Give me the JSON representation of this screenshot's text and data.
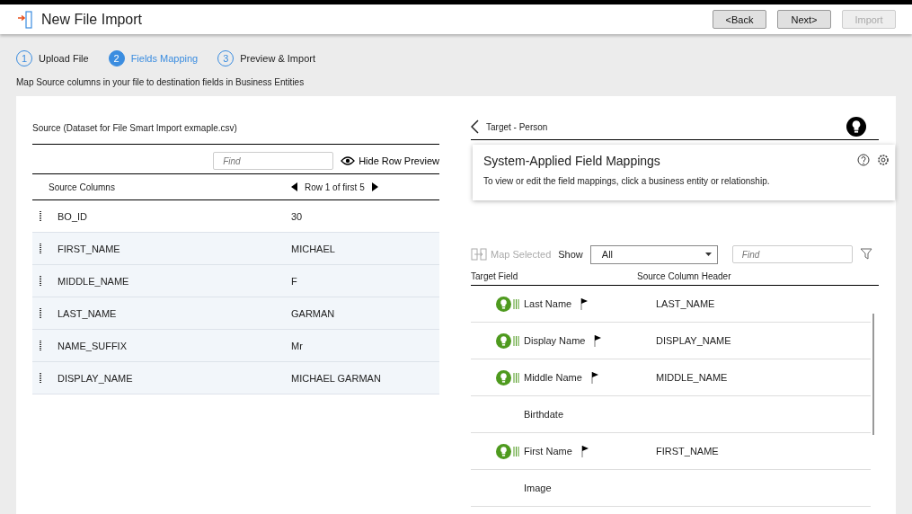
{
  "window": {
    "title": "New File Import"
  },
  "buttons": [
    {
      "label": "<Back",
      "disabled": false
    },
    {
      "label": "Next>",
      "disabled": false
    },
    {
      "label": "Import",
      "disabled": true
    }
  ],
  "steps": [
    {
      "number": "1",
      "label": "Upload File",
      "selected": false
    },
    {
      "number": "2",
      "label": "Fields Mapping",
      "selected": true
    },
    {
      "number": "3",
      "label": "Preview & Import",
      "selected": false
    }
  ],
  "instructions": "Map Source columns in your file to destination fields in Business Entities",
  "source": {
    "title": "Source (Dataset for File Smart Import exmaple.csv)",
    "find_placeholder": "Find",
    "preview_toggle": "Hide Row Preview",
    "column_header": "Source Columns",
    "row_nav": "Row 1 of first 5",
    "rows": [
      {
        "column": "BO_ID",
        "value": "30",
        "highlighted": false
      },
      {
        "column": "FIRST_NAME",
        "value": "MICHAEL",
        "highlighted": true
      },
      {
        "column": "MIDDLE_NAME",
        "value": "F",
        "highlighted": true
      },
      {
        "column": "LAST_NAME",
        "value": "GARMAN",
        "highlighted": true
      },
      {
        "column": "NAME_SUFFIX",
        "value": "Mr",
        "highlighted": true
      },
      {
        "column": "DISPLAY_NAME",
        "value": "MICHAEL GARMAN",
        "highlighted": true
      }
    ]
  },
  "target": {
    "title": "Target - Person",
    "popover": {
      "title": "System-Applied Field Mappings",
      "text": "To view or edit the field mappings, click a business entity or relationship."
    },
    "map_selected": {
      "label": "Map Selected",
      "disabled": true
    },
    "show_label": "Show",
    "show_value": "All",
    "find_placeholder": "Find",
    "columns": [
      "Target Field",
      "Source Column Header"
    ],
    "rows": [
      {
        "field": "Last Name",
        "suggested": true,
        "source": "LAST_NAME"
      },
      {
        "field": "Display Name",
        "suggested": true,
        "source": "DISPLAY_NAME"
      },
      {
        "field": "Middle Name",
        "suggested": true,
        "source": "MIDDLE_NAME"
      },
      {
        "field": "Birthdate",
        "suggested": false
      },
      {
        "field": "First Name",
        "suggested": true,
        "source": "FIRST_NAME"
      },
      {
        "field": "Image",
        "suggested": false
      }
    ]
  }
}
